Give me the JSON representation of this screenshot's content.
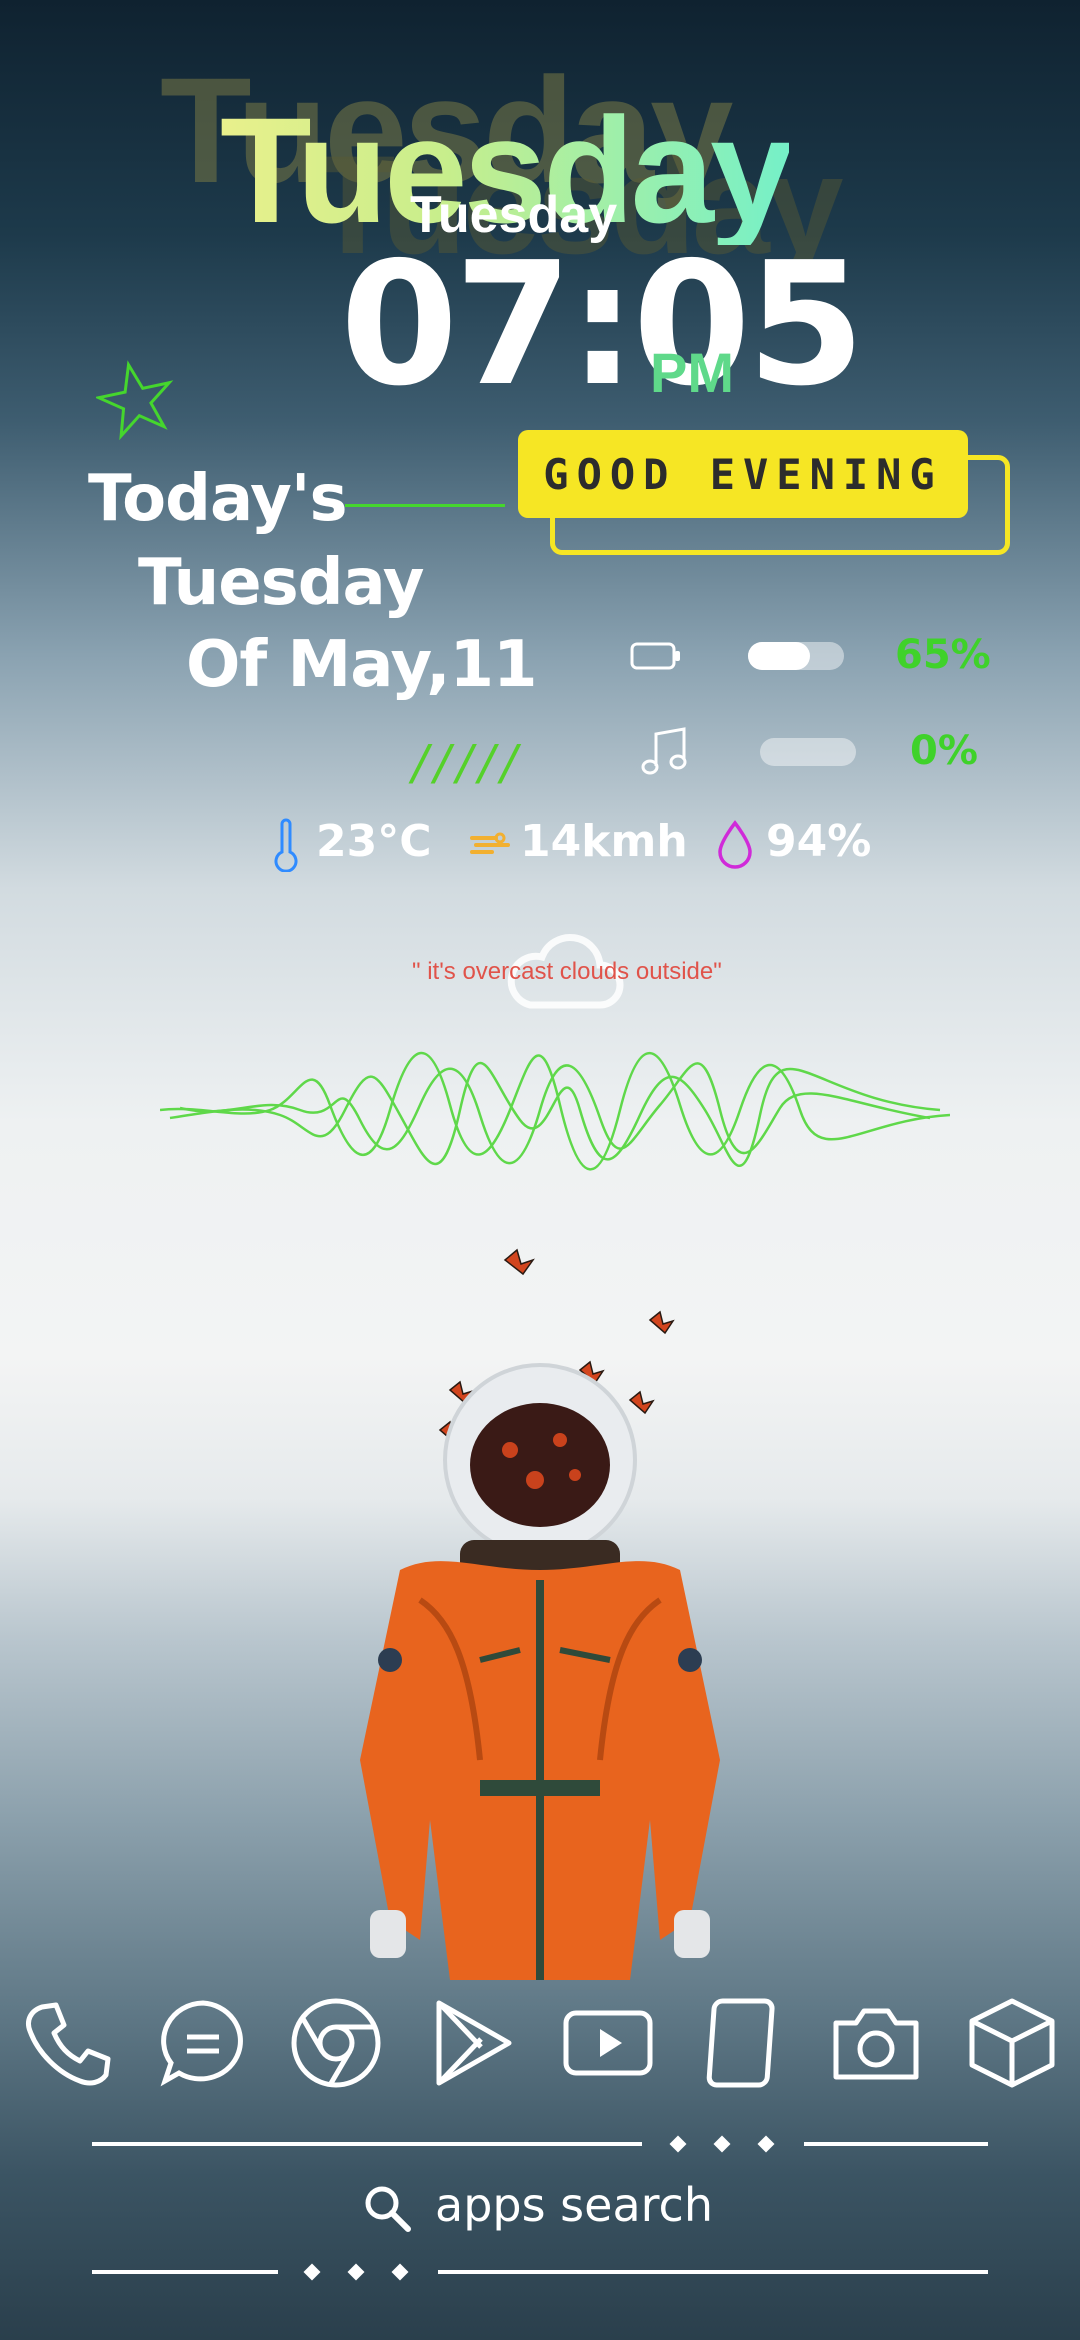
{
  "header": {
    "day_ghost": "Tuesday",
    "day_big": "Tuesday",
    "day_small": "Tuesday",
    "time": "07:05",
    "ampm": "PM"
  },
  "greeting": {
    "label": "GOOD EVENING"
  },
  "date": {
    "line1": "Today's",
    "line2": "Tuesday",
    "line3": "Of May,11"
  },
  "status": {
    "battery": {
      "icon": "battery-icon",
      "level": 0.65,
      "label": "65%"
    },
    "music": {
      "icon": "music-note-icon",
      "level": 0.0,
      "label": "0%"
    },
    "slashes": "/////"
  },
  "weather": {
    "temperature": "23°C",
    "wind": "14kmh",
    "humidity": "94%",
    "quote": "\" it's overcast clouds outside\"",
    "icons": [
      "thermometer-icon",
      "wind-icon",
      "droplet-icon",
      "cloud-icon"
    ]
  },
  "dock": {
    "apps": [
      "phone-icon",
      "messages-icon",
      "chrome-icon",
      "play-store-icon",
      "youtube-icon",
      "tablet-icon",
      "camera-icon",
      "box-icon"
    ]
  },
  "search": {
    "label": "apps search",
    "icon": "search-icon"
  },
  "colors": {
    "accent_green": "#45d62d",
    "greeting_yellow": "#f6e624",
    "quote_red": "#e0534a",
    "thermometer_blue": "#2f8bff",
    "wind_orange": "#f2b030",
    "humidity_magenta": "#d02ad9"
  }
}
